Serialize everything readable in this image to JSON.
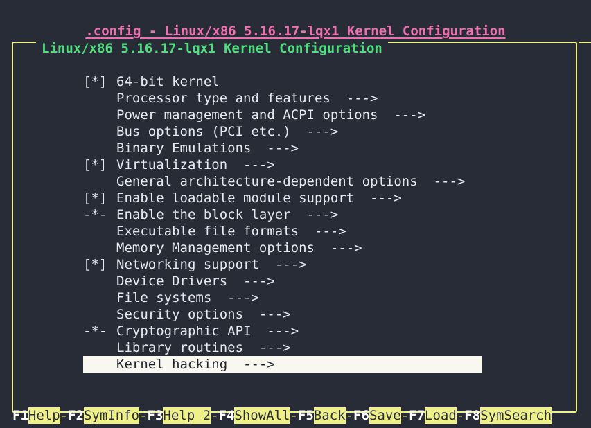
{
  "window": {
    "title": ".config - Linux/x86 5.16.17-lqx1 Kernel Configuration",
    "frame_label": "Linux/x86 5.16.17-lqx1 Kernel Configuration"
  },
  "colors": {
    "background": "#282c37",
    "title_pink": "#f06fb0",
    "frame_yellow": "#eef08a",
    "label_green": "#4ee07e",
    "text": "#e8e9ef",
    "selection_bg": "#f8f8f0",
    "selection_fg": "#23252e"
  },
  "menu": {
    "items": [
      {
        "marker": "[*]",
        "label": "64-bit kernel",
        "selected": false
      },
      {
        "marker": "",
        "label": "Processor type and features  --->",
        "selected": false
      },
      {
        "marker": "",
        "label": "Power management and ACPI options  --->",
        "selected": false
      },
      {
        "marker": "",
        "label": "Bus options (PCI etc.)  --->",
        "selected": false
      },
      {
        "marker": "",
        "label": "Binary Emulations  --->",
        "selected": false
      },
      {
        "marker": "[*]",
        "label": "Virtualization  --->",
        "selected": false
      },
      {
        "marker": "",
        "label": "General architecture-dependent options  --->",
        "selected": false
      },
      {
        "marker": "[*]",
        "label": "Enable loadable module support  --->",
        "selected": false
      },
      {
        "marker": "-*-",
        "label": "Enable the block layer  --->",
        "selected": false
      },
      {
        "marker": "",
        "label": "Executable file formats  --->",
        "selected": false
      },
      {
        "marker": "",
        "label": "Memory Management options  --->",
        "selected": false
      },
      {
        "marker": "[*]",
        "label": "Networking support  --->",
        "selected": false
      },
      {
        "marker": "",
        "label": "Device Drivers  --->",
        "selected": false
      },
      {
        "marker": "",
        "label": "File systems  --->",
        "selected": false
      },
      {
        "marker": "",
        "label": "Security options  --->",
        "selected": false
      },
      {
        "marker": "-*-",
        "label": "Cryptographic API  --->",
        "selected": false
      },
      {
        "marker": "",
        "label": "Library routines  --->",
        "selected": false
      },
      {
        "marker": "",
        "label": "Kernel hacking  --->",
        "selected": true
      }
    ]
  },
  "function_bar": {
    "separator": "-",
    "keys": [
      {
        "key": "F1",
        "action": "Help"
      },
      {
        "key": "F2",
        "action": "SymInfo"
      },
      {
        "key": "F3",
        "action": "Help 2"
      },
      {
        "key": "F4",
        "action": "ShowAll"
      },
      {
        "key": "F5",
        "action": "Back"
      },
      {
        "key": "F6",
        "action": "Save"
      },
      {
        "key": "F7",
        "action": "Load"
      },
      {
        "key": "F8",
        "action": "SymSearch"
      }
    ]
  }
}
